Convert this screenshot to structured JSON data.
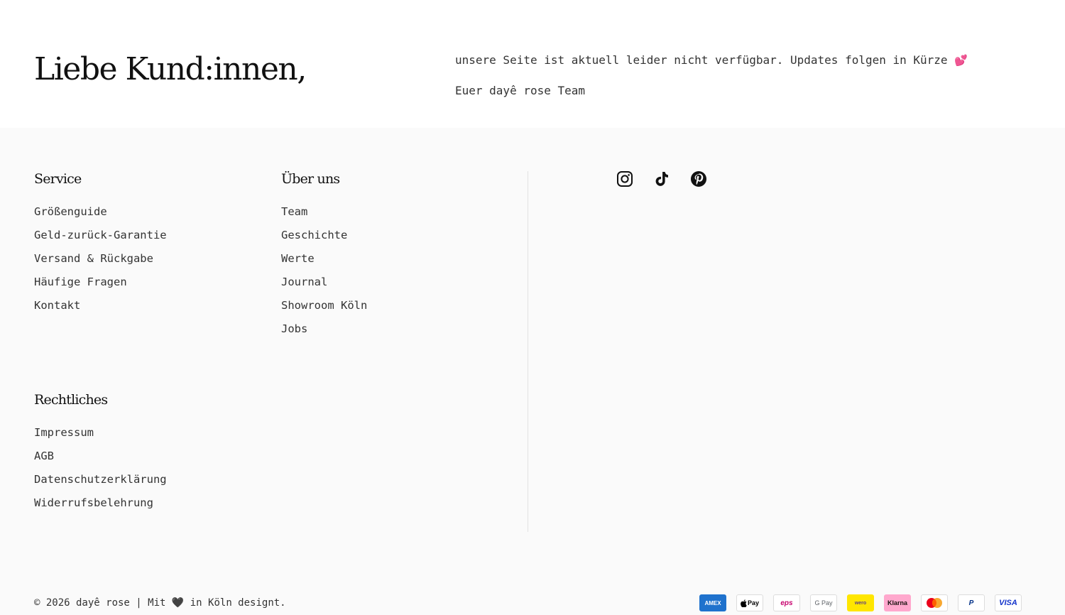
{
  "hero": {
    "title": "Liebe Kund:innen,",
    "message": "unsere Seite ist aktuell leider nicht verfügbar. Updates folgen in Kürze",
    "message_emoji": "💕",
    "signature": "Euer dayê rose Team"
  },
  "footer": {
    "service": {
      "heading": "Service",
      "links": [
        "Größenguide",
        "Geld-zurück-Garantie",
        "Versand & Rückgabe",
        "Häufige Fragen",
        "Kontakt"
      ]
    },
    "about": {
      "heading": "Über uns",
      "links": [
        "Team",
        "Geschichte",
        "Werte",
        "Journal",
        "Showroom Köln",
        "Jobs"
      ]
    },
    "legal": {
      "heading": "Rechtliches",
      "links": [
        "Impressum",
        "AGB",
        "Datenschutzerklärung",
        "Widerrufsbelehrung"
      ]
    },
    "social": [
      {
        "icon": "instagram-icon"
      },
      {
        "icon": "tiktok-icon"
      },
      {
        "icon": "pinterest-icon"
      }
    ],
    "copyright": {
      "prefix": "© 2026 dayê rose | Mit",
      "heart": "🖤",
      "suffix": "in Köln designt."
    },
    "payments": {
      "amex": "AMEX",
      "applepay": "Pay",
      "eps": "eps",
      "gpay": "G Pay",
      "wero": "wero",
      "klarna": "Klarna",
      "paypal": "P",
      "visa": "VISA"
    }
  },
  "colors": {
    "footer_bg": "#fafafa",
    "text": "#333333",
    "heading": "#111111",
    "amex": "#1f72cd",
    "klarna": "#ffa8cd",
    "wero": "#ffe600",
    "mastercard_red": "#eb001b",
    "mastercard_orange": "#f79e1b",
    "visa": "#1434cb"
  }
}
